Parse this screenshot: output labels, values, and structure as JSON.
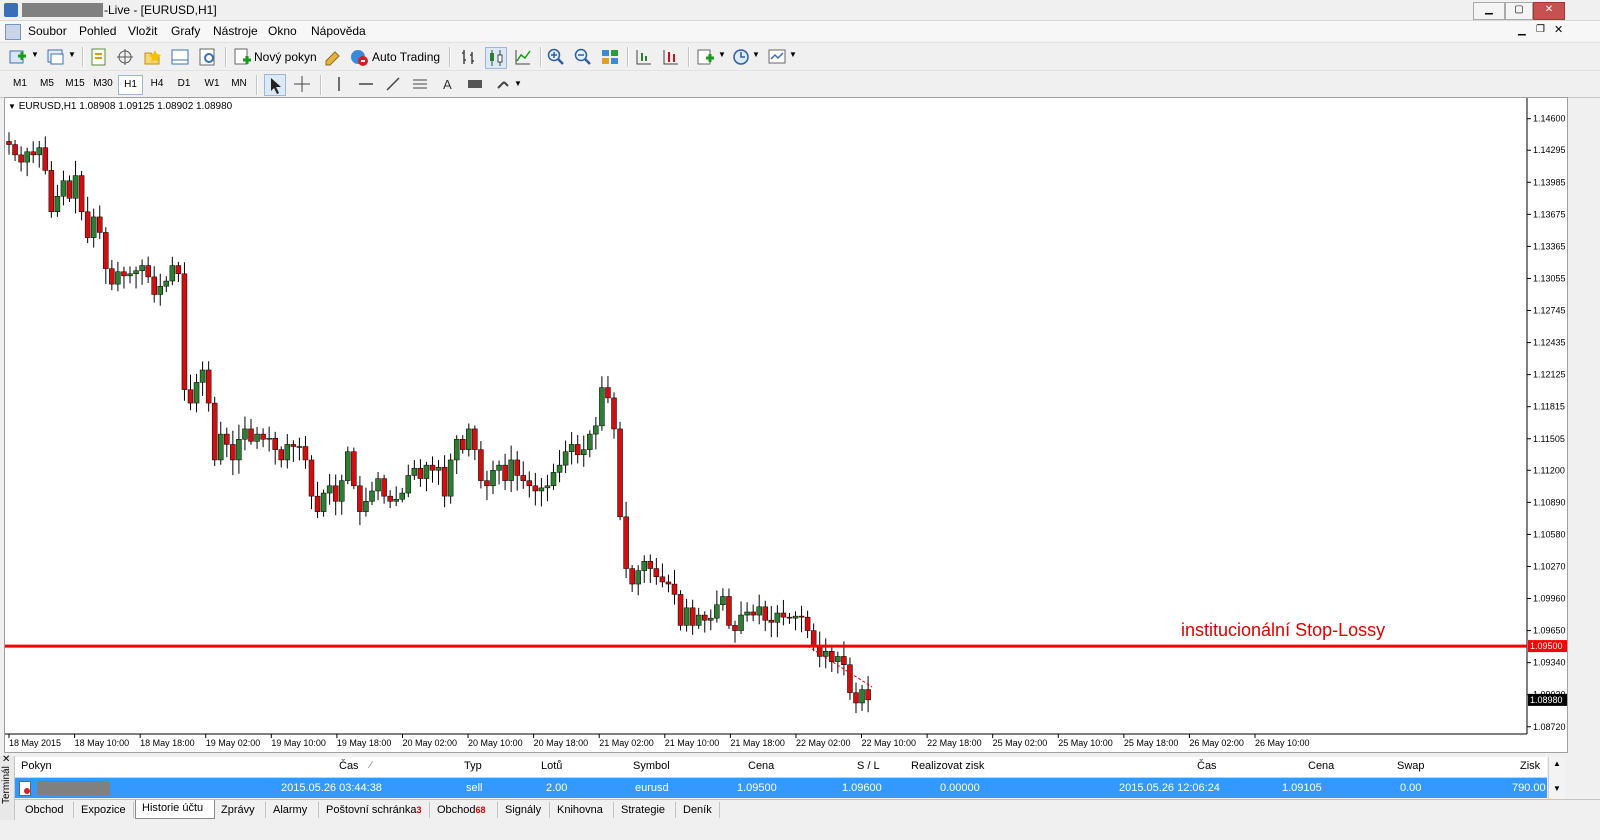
{
  "window": {
    "title": "-Live - [EURUSD,H1]",
    "buttons": [
      "▁",
      "▢",
      "✕"
    ]
  },
  "menu": [
    "Soubor",
    "Pohled",
    "Vložit",
    "Grafy",
    "Nástroje",
    "Okno",
    "Nápověda"
  ],
  "toolbar": {
    "new_order": "Nový pokyn",
    "auto_trading": "Auto Trading"
  },
  "timeframes": [
    "M1",
    "M5",
    "M15",
    "M30",
    "H1",
    "H4",
    "D1",
    "W1",
    "MN"
  ],
  "active_timeframe": "H1",
  "chart_label": "EURUSD,H1  1.08908 1.09125 1.08902 1.08980",
  "annotation": "institucionální Stop-Lossy",
  "chart_data": {
    "type": "candlestick",
    "symbol": "EURUSD",
    "timeframe": "H1",
    "ylim": [
      1.0865,
      1.148
    ],
    "yticks": [
      "1.14600",
      "1.14295",
      "1.13985",
      "1.13675",
      "1.13365",
      "1.13055",
      "1.12745",
      "1.12435",
      "1.12125",
      "1.11815",
      "1.11505",
      "1.11200",
      "1.10890",
      "1.10580",
      "1.10270",
      "1.09960",
      "1.09650",
      "1.09340",
      "1.09030",
      "1.08720"
    ],
    "xticks": [
      "18 May 2015",
      "18 May 10:00",
      "18 May 18:00",
      "19 May 02:00",
      "19 May 10:00",
      "19 May 18:00",
      "20 May 02:00",
      "20 May 10:00",
      "20 May 18:00",
      "21 May 02:00",
      "21 May 10:00",
      "21 May 18:00",
      "22 May 02:00",
      "22 May 10:00",
      "22 May 18:00",
      "25 May 02:00",
      "25 May 10:00",
      "25 May 18:00",
      "26 May 02:00",
      "26 May 10:00"
    ],
    "hline": {
      "value": 1.095,
      "label": "1.09500",
      "color": "#ff0000"
    },
    "current_price": {
      "value": 1.0898,
      "label": "1.08980"
    },
    "bull_color": "#2e7d32",
    "bear_color": "#d01010",
    "closes": [
      1.1435,
      1.1425,
      1.1418,
      1.1428,
      1.1425,
      1.1432,
      1.141,
      1.137,
      1.1385,
      1.14,
      1.1383,
      1.1405,
      1.137,
      1.1345,
      1.1365,
      1.135,
      1.1315,
      1.13,
      1.1312,
      1.1308,
      1.131,
      1.1313,
      1.1318,
      1.1307,
      1.129,
      1.1298,
      1.1303,
      1.1318,
      1.131,
      1.1198,
      1.1185,
      1.1205,
      1.1217,
      1.1185,
      1.113,
      1.1155,
      1.1145,
      1.113,
      1.115,
      1.116,
      1.1148,
      1.1155,
      1.115,
      1.1151,
      1.114,
      1.113,
      1.1145,
      1.1143,
      1.1143,
      1.113,
      1.1095,
      1.108,
      1.1098,
      1.1105,
      1.109,
      1.111,
      1.1138,
      1.1105,
      1.108,
      1.109,
      1.11,
      1.1112,
      1.1095,
      1.109,
      1.1092,
      1.1098,
      1.1115,
      1.1122,
      1.1112,
      1.1125,
      1.112,
      1.1123,
      1.1095,
      1.113,
      1.115,
      1.114,
      1.116,
      1.114,
      1.111,
      1.1105,
      1.112,
      1.1125,
      1.111,
      1.113,
      1.1115,
      1.111,
      1.1105,
      1.11,
      1.1103,
      1.1105,
      1.1118,
      1.1125,
      1.1138,
      1.1145,
      1.1135,
      1.114,
      1.1155,
      1.1163,
      1.12,
      1.119,
      1.116,
      1.1075,
      1.1025,
      1.101,
      1.1023,
      1.1032,
      1.1025,
      1.1017,
      1.1012,
      1.101,
      1.1,
      1.097,
      1.0987,
      1.097,
      1.098,
      1.0975,
      1.0977,
      1.099,
      1.0998,
      1.097,
      1.0965,
      1.098,
      1.0983,
      1.098,
      1.0988,
      1.0975,
      1.0973,
      1.0982,
      1.0978,
      1.0977,
      1.0979,
      1.0978,
      1.0965,
      1.095,
      1.094,
      1.0945,
      1.0935,
      1.094,
      1.0932,
      1.0905,
      1.0895,
      1.0908,
      1.0898
    ]
  },
  "terminal": {
    "side_label": "Terminál",
    "headers": [
      "Pokyn",
      "Čas",
      "Typ",
      "Lotů",
      "Symbol",
      "Cena",
      "S / L",
      "Realizovat zisk",
      "Čas",
      "Cena",
      "Swap",
      "Zisk"
    ],
    "row": {
      "time": "2015.05.26 03:44:38",
      "type": "sell",
      "lots": "2.00",
      "symbol": "eurusd",
      "price": "1.09500",
      "sl": "1.09600",
      "tp": "0.00000",
      "close_time": "2015.05.26 12:06:24",
      "close_price": "1.09105",
      "swap": "0.00",
      "profit": "790.00"
    },
    "tabs": [
      {
        "label": "Obchod",
        "badge": ""
      },
      {
        "label": "Expozice",
        "badge": ""
      },
      {
        "label": "Historie účtu",
        "badge": ""
      },
      {
        "label": "Zprávy",
        "badge": ""
      },
      {
        "label": "Alarmy",
        "badge": ""
      },
      {
        "label": "Poštovní schránka",
        "badge": "3"
      },
      {
        "label": "Obchod",
        "badge": "68"
      },
      {
        "label": "Signály",
        "badge": ""
      },
      {
        "label": "Knihovna",
        "badge": ""
      },
      {
        "label": "Strategie",
        "badge": ""
      },
      {
        "label": "Deník",
        "badge": ""
      }
    ],
    "active_tab": "Historie účtu"
  }
}
